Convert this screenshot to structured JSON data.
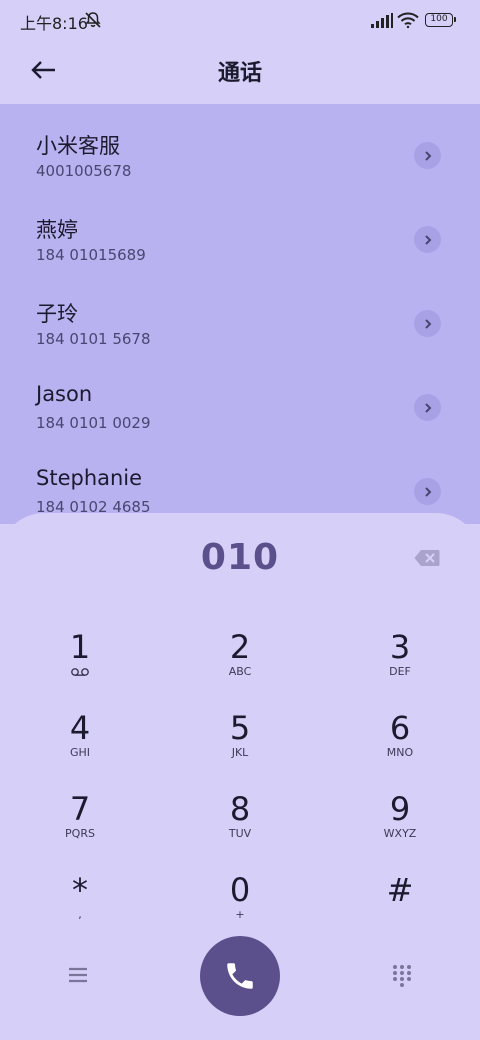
{
  "status": {
    "time": "上午8:16",
    "battery": "100",
    "icons": [
      "notifications-muted-icon",
      "signal-icon",
      "wifi-icon",
      "battery-icon"
    ]
  },
  "header": {
    "title": "通话",
    "back_icon": "arrow-left-icon"
  },
  "contacts": [
    {
      "name": "小米客服",
      "number": "4001005678"
    },
    {
      "name": "燕婷",
      "number": "184 01015689"
    },
    {
      "name": "子玲",
      "number": "184 0101 5678"
    },
    {
      "name": "Jason",
      "number": "184 0101 0029"
    },
    {
      "name": "Stephanie",
      "number": "184 0102 4685"
    }
  ],
  "dialer": {
    "input": "010",
    "keys": [
      {
        "digit": "1",
        "letters": ""
      },
      {
        "digit": "2",
        "letters": "ABC"
      },
      {
        "digit": "3",
        "letters": "DEF"
      },
      {
        "digit": "4",
        "letters": "GHI"
      },
      {
        "digit": "5",
        "letters": "JKL"
      },
      {
        "digit": "6",
        "letters": "MNO"
      },
      {
        "digit": "7",
        "letters": "PQRS"
      },
      {
        "digit": "8",
        "letters": "TUV"
      },
      {
        "digit": "9",
        "letters": "WXYZ"
      },
      {
        "digit": "*",
        "letters": ","
      },
      {
        "digit": "0",
        "letters": "+"
      },
      {
        "digit": "#",
        "letters": ""
      }
    ],
    "bottom_icons": [
      "menu-icon",
      "phone-icon",
      "dialpad-icon"
    ]
  },
  "colors": {
    "background": "#d6d0f8",
    "list_background": "#b9b2f1",
    "accent": "#5b4f8c"
  }
}
